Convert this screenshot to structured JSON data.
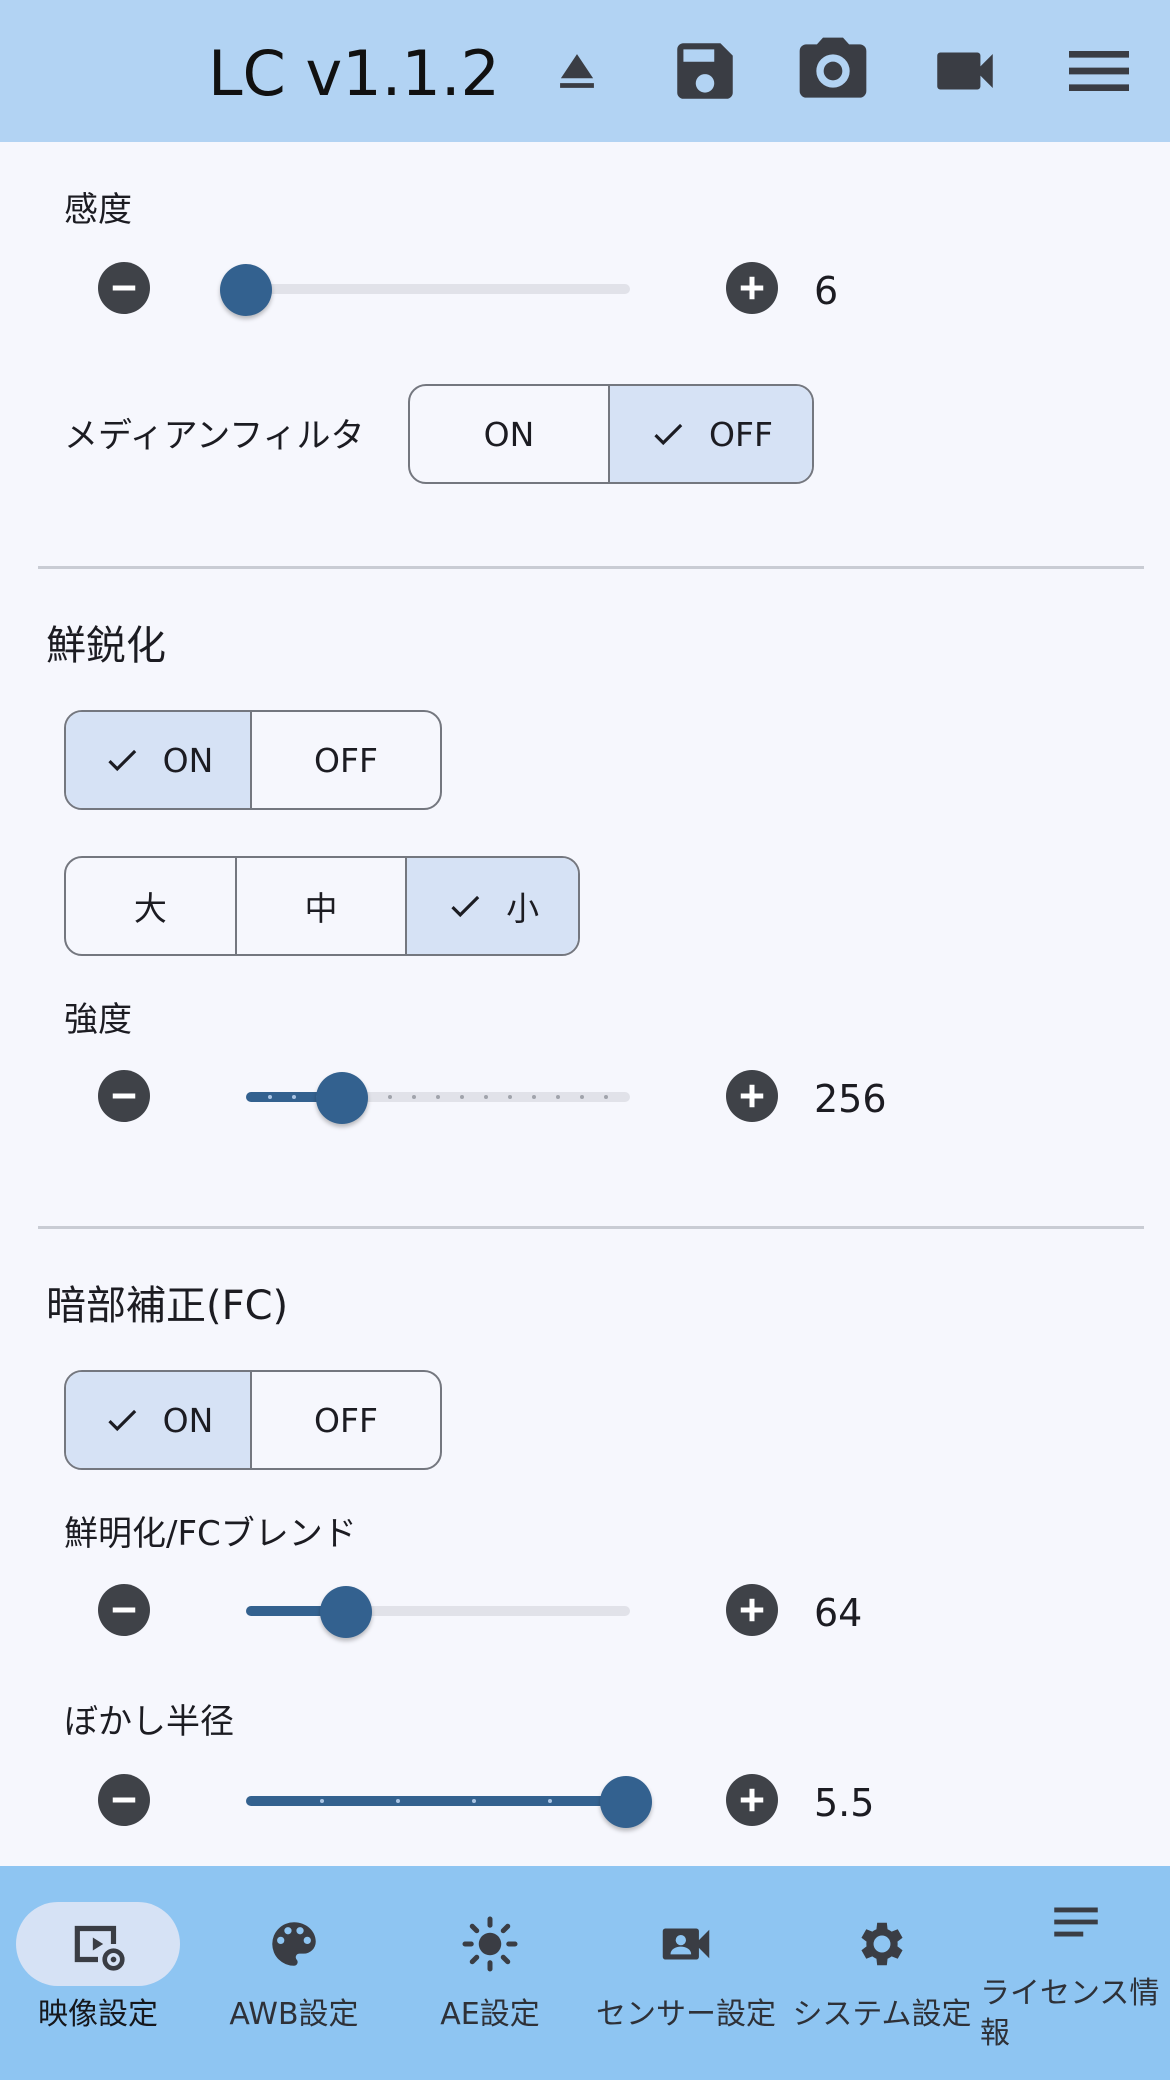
{
  "header": {
    "title": "LC v1.1.2",
    "icons": [
      "eject-icon",
      "save-icon",
      "camera-icon",
      "video-icon",
      "menu-icon"
    ]
  },
  "sensitivity": {
    "label": "感度",
    "value": "6",
    "level": 0.0
  },
  "median_filter": {
    "label": "メディアンフィルタ",
    "options": [
      "ON",
      "OFF"
    ],
    "selected": "OFF"
  },
  "sharpening": {
    "title": "鮮鋭化",
    "toggle": {
      "options": [
        "ON",
        "OFF"
      ],
      "selected": "ON"
    },
    "size": {
      "options": [
        "大",
        "中",
        "小"
      ],
      "selected": "小"
    },
    "strength": {
      "label": "強度",
      "value": "256",
      "level": 0.25
    }
  },
  "dark_correction": {
    "title": "暗部補正(FC)",
    "toggle": {
      "options": [
        "ON",
        "OFF"
      ],
      "selected": "ON"
    },
    "blend": {
      "label": "鮮明化/FCブレンド",
      "value": "64",
      "level": 0.26
    },
    "blur_radius": {
      "label": "ぼかし半径",
      "value": "5.5",
      "level": 1.0
    }
  },
  "bottom_nav": {
    "items": [
      {
        "label": "映像設定",
        "icon": "video-settings-icon",
        "active": true
      },
      {
        "label": "AWB設定",
        "icon": "palette-icon",
        "active": false
      },
      {
        "label": "AE設定",
        "icon": "brightness-icon",
        "active": false
      },
      {
        "label": "センサー設定",
        "icon": "camera-person-icon",
        "active": false
      },
      {
        "label": "システム設定",
        "icon": "gear-icon",
        "active": false
      },
      {
        "label": "ライセンス情報",
        "icon": "notes-icon",
        "active": false
      }
    ]
  },
  "colors": {
    "header_bg": "#b2d3f3",
    "nav_bg": "#8ec5f2",
    "accent": "#33618f",
    "selected_bg": "#d6e2f5"
  }
}
